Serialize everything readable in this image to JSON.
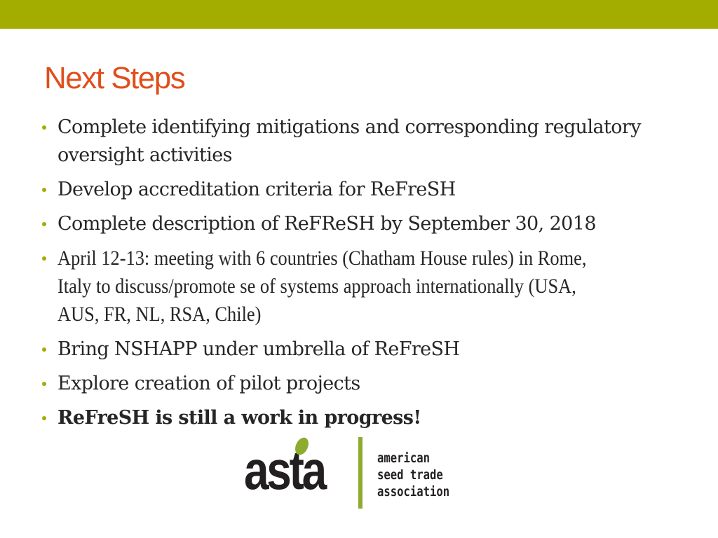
{
  "slide": {
    "accent_bar_color": "#a2ad00",
    "title": "Next Steps",
    "title_color": "#e04e1b",
    "bullets": [
      {
        "text": "Complete identifying mitigations and corresponding regulatory oversight activities",
        "bold": false
      },
      {
        "text": "Develop accreditation criteria for ReFreSH",
        "bold": false
      },
      {
        "text": "Complete description of ReFReSH by September 30, 2018",
        "bold": false
      },
      {
        "text": "April 12-13: meeting with 6 countries (Chatham House rules) in Rome, Italy to discuss/promote se of systems approach internationally (USA, AUS, FR, NL, RSA, Chile)",
        "bold": false
      },
      {
        "text": "Bring NSHAPP under umbrella of ReFreSH",
        "bold": false
      },
      {
        "text": "Explore creation of pilot projects",
        "bold": false
      },
      {
        "text": "ReFreSH is still a work in progress!",
        "bold": true
      }
    ],
    "logo": {
      "wordmark": "asta",
      "lines": [
        "american",
        "seed trade",
        "association"
      ],
      "accent_color": "#8dac2f"
    }
  }
}
